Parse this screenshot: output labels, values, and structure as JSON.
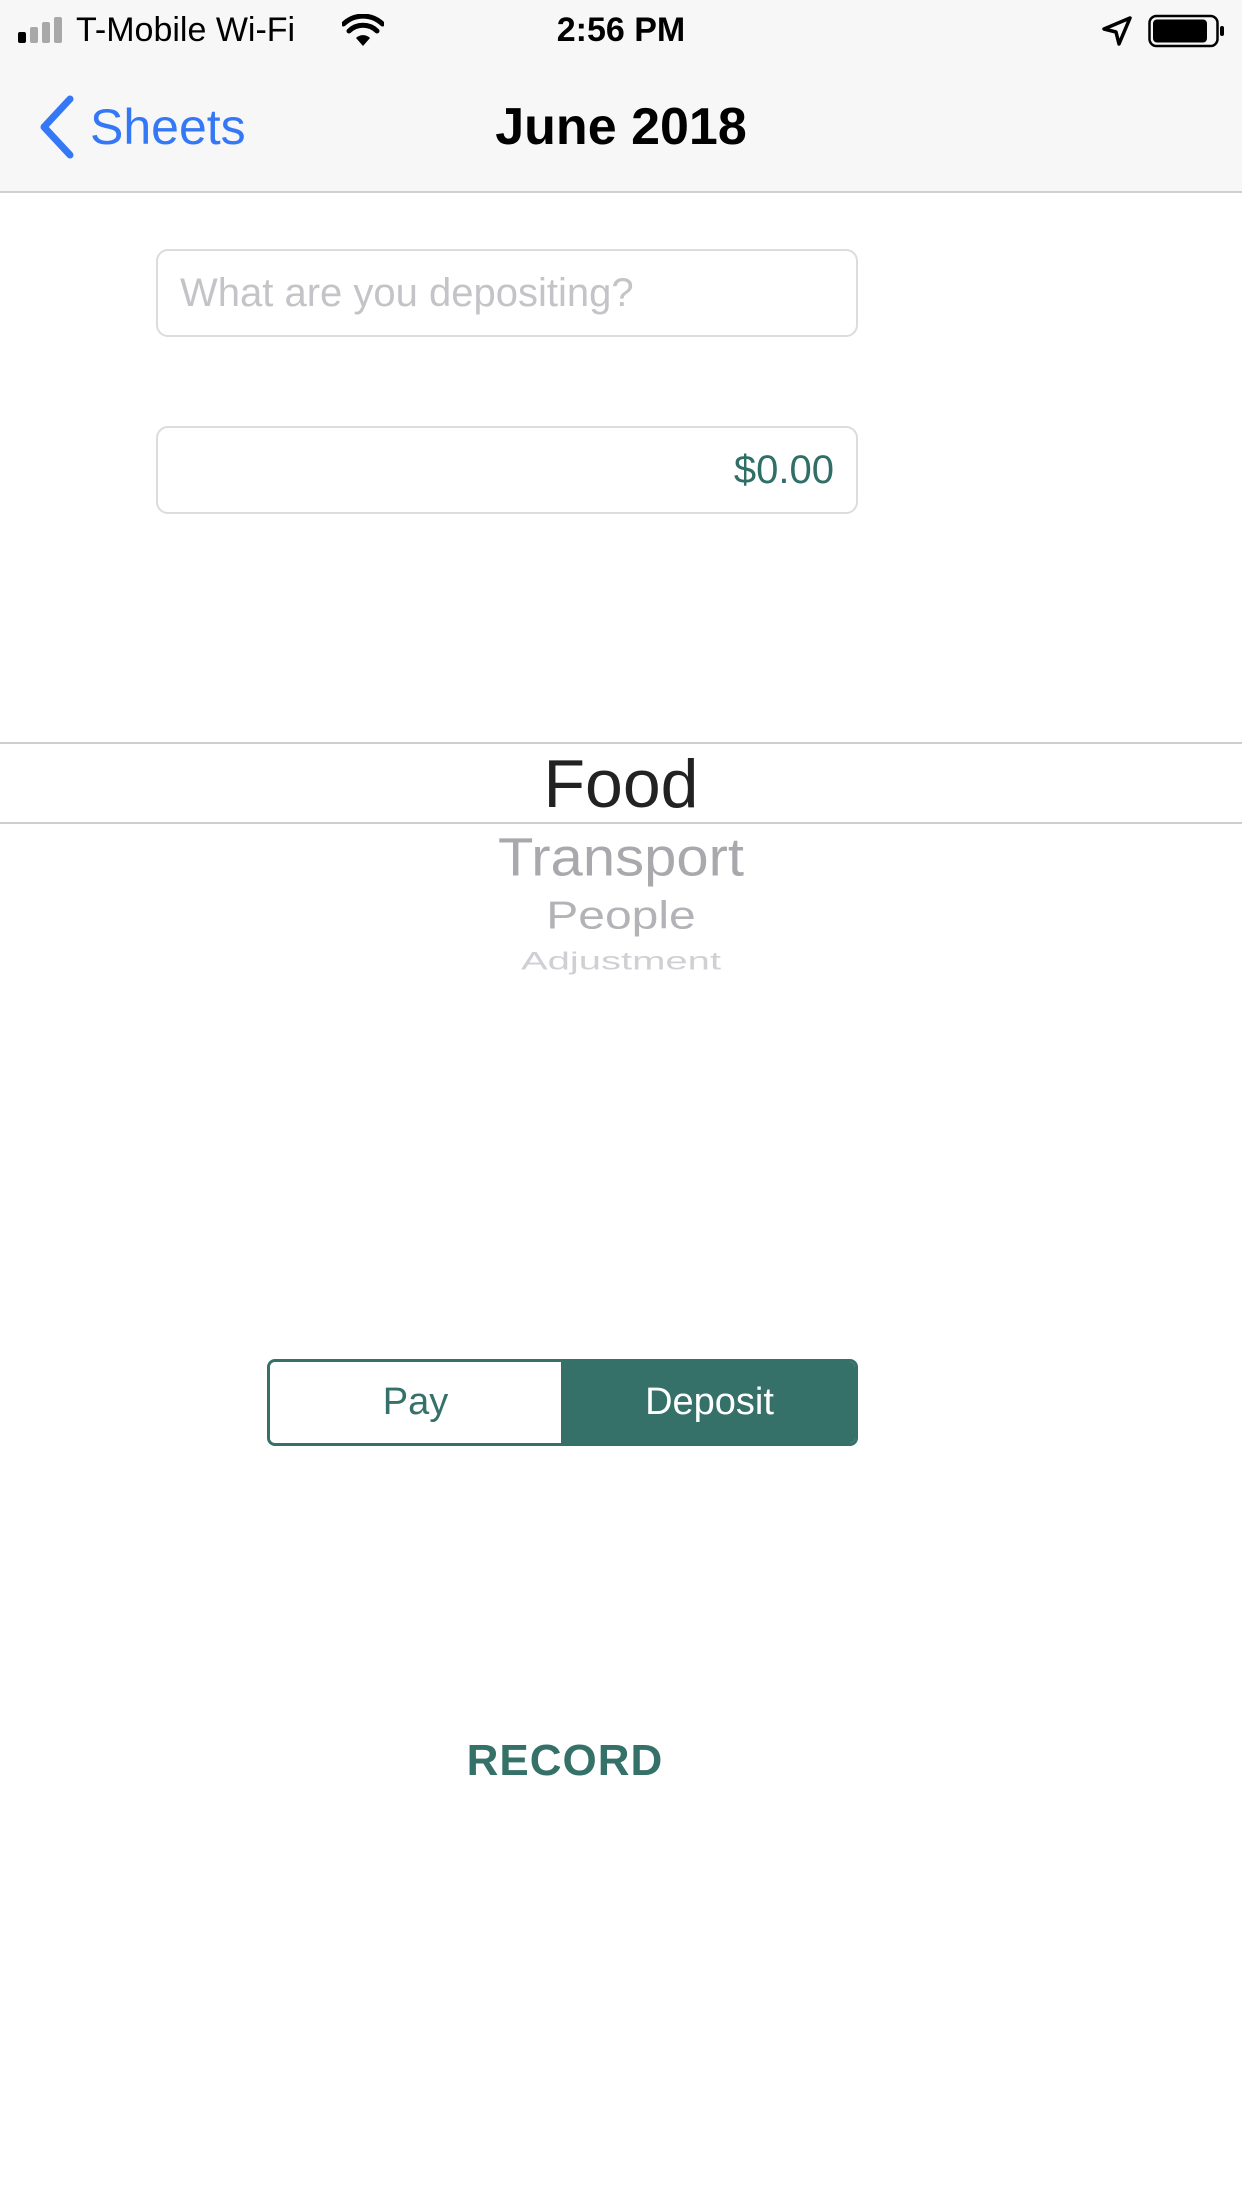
{
  "colors": {
    "accent": "#357168",
    "ios_blue": "#3478f6",
    "bar_background": "#f7f7f7"
  },
  "status_bar": {
    "carrier": "T-Mobile Wi-Fi",
    "time": "2:56 PM",
    "signal_bars_filled": 1,
    "signal_bars_total": 4,
    "battery_level": 0.85
  },
  "nav": {
    "back_label": "Sheets",
    "title": "June 2018"
  },
  "form": {
    "description_placeholder": "What are you depositing?",
    "description_value": "",
    "amount_value": "$0.00"
  },
  "picker": {
    "selected": "Food",
    "items": [
      "Food",
      "Transport",
      "People",
      "Adjustment"
    ]
  },
  "segmented": {
    "options": [
      "Pay",
      "Deposit"
    ],
    "selected": "Deposit"
  },
  "record_label": "RECORD"
}
